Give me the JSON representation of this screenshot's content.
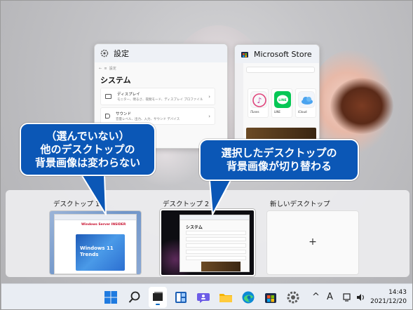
{
  "settings_window": {
    "title": "設定",
    "heading": "システム",
    "rows": [
      {
        "title": "ディスプレイ",
        "sub": "モニター、明るさ、夜間モード、ディスプレイ プロファイル"
      },
      {
        "title": "サウンド",
        "sub": "音量レベル、出力、入力、サウンド デバイス"
      }
    ]
  },
  "store_window": {
    "title": "Microsoft Store",
    "apps": [
      {
        "name": "iTunes",
        "color": "#f7f7f9"
      },
      {
        "name": "LINE",
        "color": "#06c755"
      },
      {
        "name": "iCloud",
        "color": "#f1f5fb"
      }
    ]
  },
  "callouts": {
    "left": [
      "（選んでいない）",
      "他のデスクトップの",
      "背景画像は変わらない"
    ],
    "right": [
      "選択したデスクトップの",
      "背景画像が切り替わる"
    ]
  },
  "desktops": [
    {
      "label": "デスクトップ 1",
      "selected": false
    },
    {
      "label": "デスクトップ 2",
      "selected": true
    },
    {
      "label": "新しいデスクトップ",
      "is_new": true
    }
  ],
  "new_desktop_symbol": "+",
  "thumb1": {
    "banner": "Windows Server INSIDER",
    "article_lines": [
      "Windows 11",
      "Trends"
    ]
  },
  "thumb2": {
    "heading": "システム"
  },
  "taskbar": {
    "icons": [
      "start-icon",
      "search-icon",
      "task-view-icon",
      "widgets-icon",
      "chat-icon",
      "file-explorer-icon",
      "edge-icon",
      "store-icon",
      "settings-icon"
    ],
    "tray": {
      "chevron": "^",
      "ime": "A",
      "time": "14:43",
      "date": "2021/12/20"
    }
  },
  "colors": {
    "callout": "#0b57b6",
    "accent": "#0067c0"
  }
}
